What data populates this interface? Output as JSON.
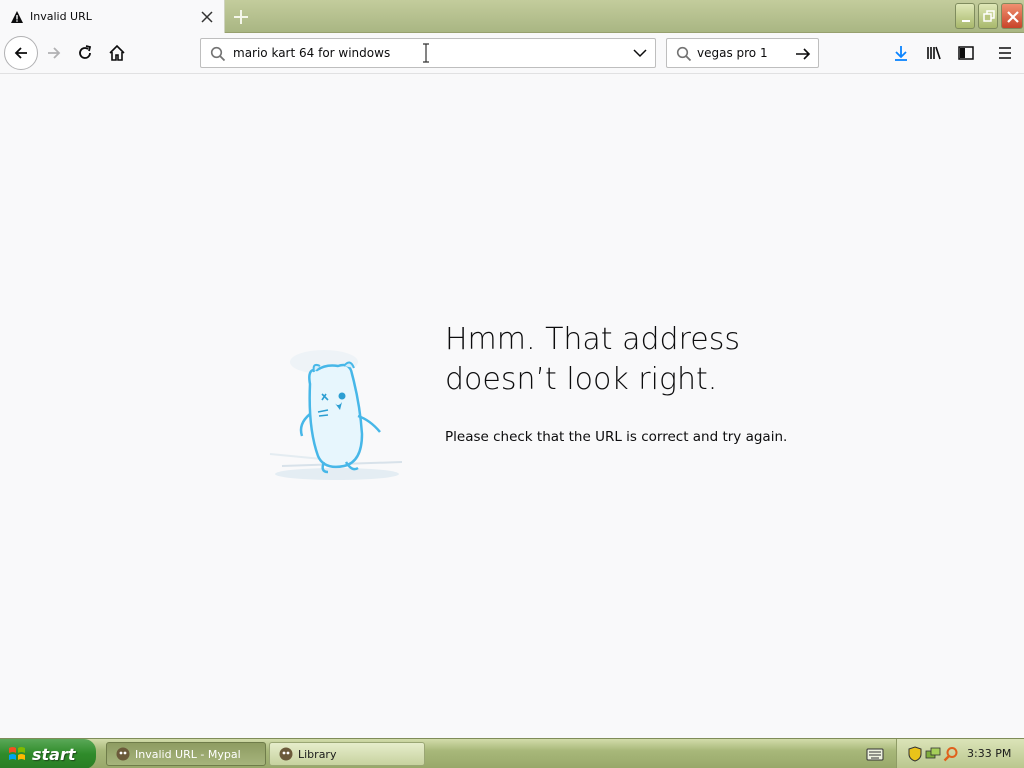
{
  "tab": {
    "title": "Invalid URL"
  },
  "urlbar": {
    "value": "mario kart 64 for windows"
  },
  "searchbar": {
    "value": "vegas pro 1"
  },
  "error": {
    "heading_line1": "Hmm. That address",
    "heading_line2": "doesn’t look right.",
    "message": "Please check that the URL is correct and try again."
  },
  "taskbar": {
    "start_label": "start",
    "tasks": [
      {
        "label": "Invalid URL - Mypal",
        "active": true
      },
      {
        "label": "Library",
        "active": false
      }
    ],
    "clock": "3:33 PM"
  },
  "colors": {
    "accent": "#0a84ff",
    "chrome": "#b7c290",
    "start_green": "#2f8b2a"
  }
}
